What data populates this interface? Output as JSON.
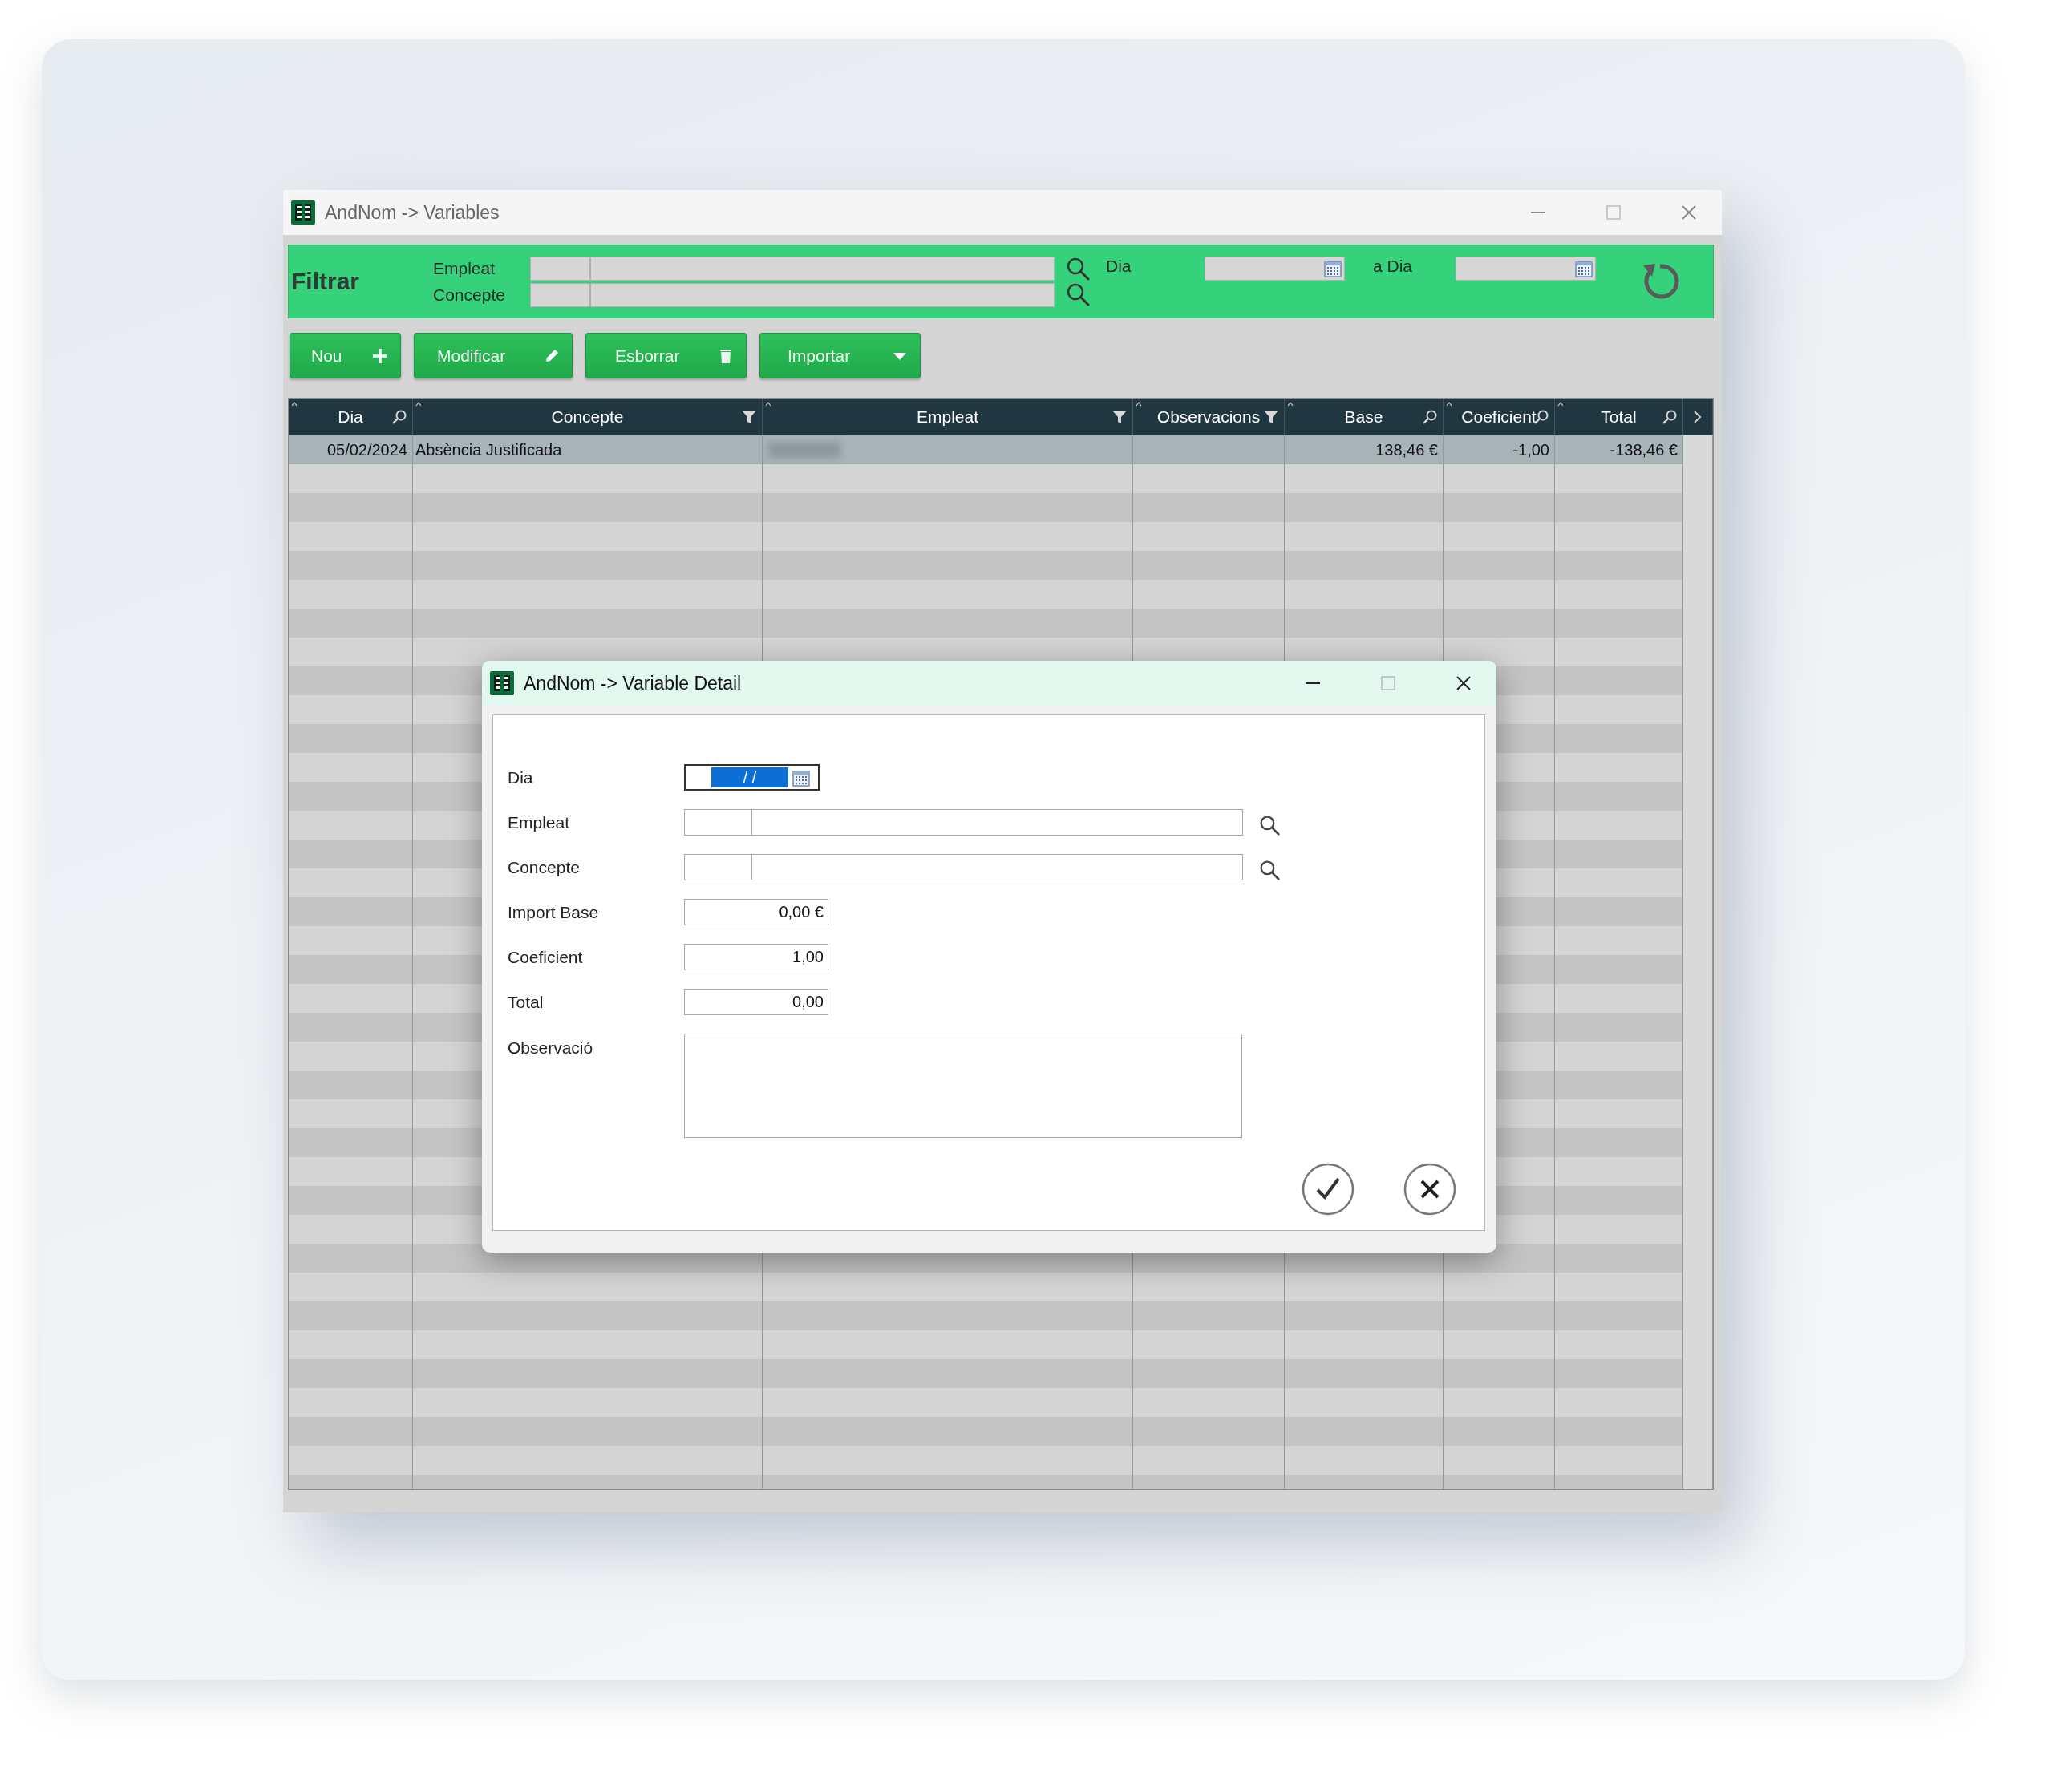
{
  "main_window": {
    "title": "AndNom -> Variables",
    "filter": {
      "heading": "Filtrar",
      "fields": [
        {
          "label": "Empleat"
        },
        {
          "label": "Concepte"
        }
      ],
      "date_from_label": "Dia",
      "date_to_label": "a Dia"
    },
    "toolbar": [
      {
        "label": "Nou"
      },
      {
        "label": "Modificar"
      },
      {
        "label": "Esborrar"
      },
      {
        "label": "Importar"
      }
    ],
    "table": {
      "columns": [
        {
          "label": "Dia"
        },
        {
          "label": "Concepte"
        },
        {
          "label": "Empleat"
        },
        {
          "label": "Observacions"
        },
        {
          "label": "Base"
        },
        {
          "label": "Coeficient"
        },
        {
          "label": "Total"
        }
      ],
      "rows": [
        {
          "selected": true,
          "cells": [
            {
              "kind": "text",
              "text": "05/02/2024"
            },
            {
              "kind": "text",
              "text": "Absència Justificada"
            },
            {
              "kind": "blurred"
            },
            {
              "kind": "empty"
            },
            {
              "kind": "text",
              "text": "138,46 €"
            },
            {
              "kind": "text",
              "text": "-1,00"
            },
            {
              "kind": "text",
              "text": "-138,46 €"
            }
          ]
        }
      ]
    }
  },
  "dialog": {
    "title": "AndNom -> Variable Detail",
    "fields": [
      {
        "label": "Dia",
        "kind": "date",
        "value": "/ /",
        "selected": true
      },
      {
        "label": "Empleat",
        "kind": "lookup"
      },
      {
        "label": "Concepte",
        "kind": "lookup"
      },
      {
        "label": "Import Base",
        "kind": "number",
        "value": "0,00 €"
      },
      {
        "label": "Coeficient",
        "kind": "number",
        "value": "1,00"
      },
      {
        "label": "Total",
        "kind": "number",
        "value": "0,00"
      },
      {
        "label": "Observació",
        "kind": "textarea"
      }
    ],
    "buttons": [
      {
        "kind": "confirm"
      },
      {
        "kind": "cancel"
      }
    ]
  }
}
